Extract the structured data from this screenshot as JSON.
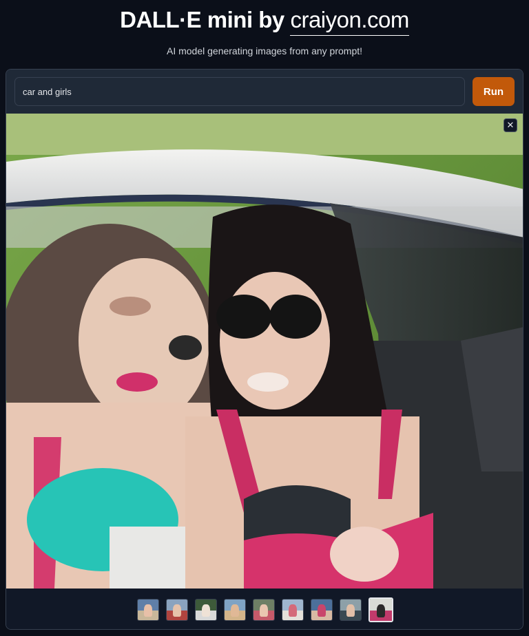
{
  "header": {
    "title_prefix": "DALL·E mini by ",
    "title_link": "craiyon.com",
    "subtitle": "AI model generating images from any prompt!"
  },
  "prompt": {
    "value": "car and girls",
    "run_label": "Run"
  },
  "result": {
    "close_glyph": "✕"
  },
  "thumbnails": [
    {
      "bg": "#5f7fa8",
      "fg": "#c9b79a",
      "fig": "#e8c0a8",
      "selected": false
    },
    {
      "bg": "#8aa3bf",
      "fg": "#b0443f",
      "fig": "#e6c2aa",
      "selected": false
    },
    {
      "bg": "#3d5a3a",
      "fg": "#d9d9d9",
      "fig": "#efe2d6",
      "selected": false
    },
    {
      "bg": "#7fa3c4",
      "fg": "#d3b48a",
      "fig": "#e0b896",
      "selected": false
    },
    {
      "bg": "#6e7f65",
      "fg": "#c65a6a",
      "fig": "#eac6b0",
      "selected": false
    },
    {
      "bg": "#9fb6cf",
      "fg": "#e4e0da",
      "fig": "#d46a7a",
      "selected": false
    },
    {
      "bg": "#4c6f9a",
      "fg": "#d8b9a3",
      "fig": "#c9456b",
      "selected": false
    },
    {
      "bg": "#8da0a8",
      "fg": "#3a4a52",
      "fig": "#e2c0a8",
      "selected": false
    },
    {
      "bg": "#d9dcd6",
      "fg": "#c23a6b",
      "fig": "#2a2a2a",
      "selected": true
    }
  ]
}
